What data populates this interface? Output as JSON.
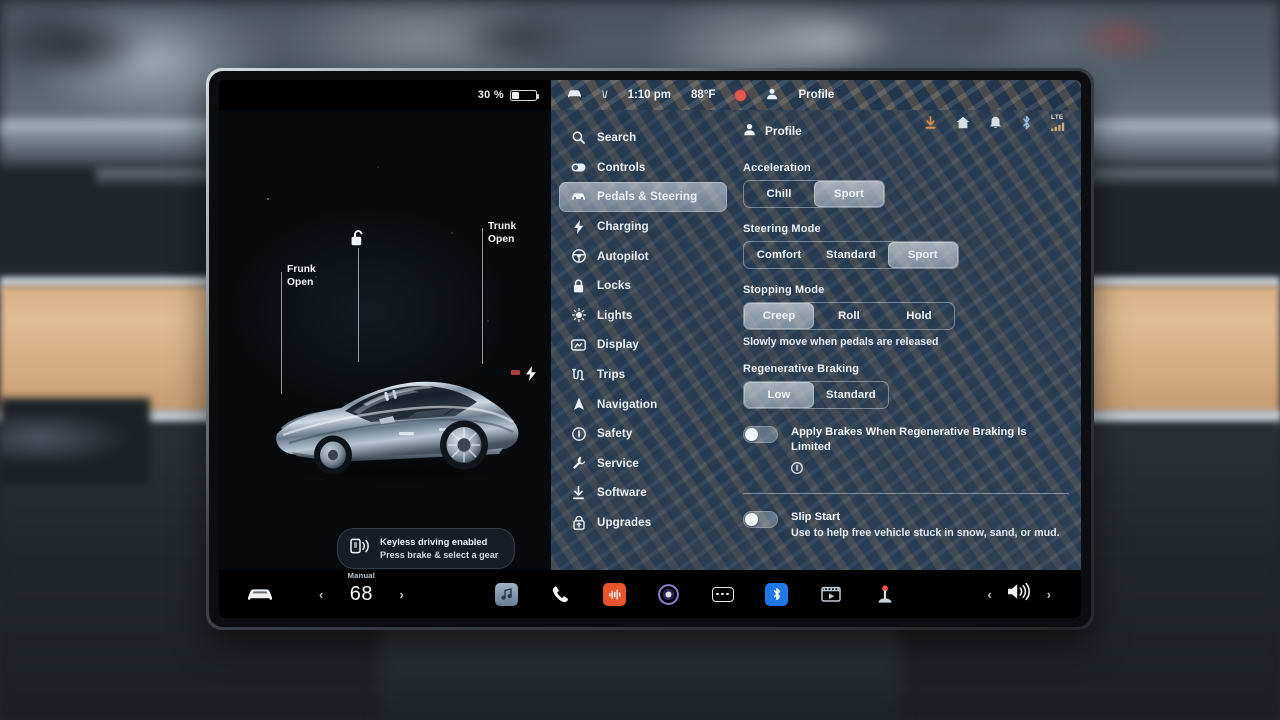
{
  "status_bar": {
    "battery_percent": "30 %",
    "battery_level": 30,
    "time": "1:10 pm",
    "temperature": "88°F",
    "profile_label": "Profile",
    "icons": [
      "download-icon",
      "home-icon",
      "bell-icon",
      "bluetooth-icon",
      "lte-signal-icon"
    ],
    "network": "LTE"
  },
  "sidebar": {
    "items": [
      {
        "label": "Search",
        "icon": "search-icon",
        "selected": false
      },
      {
        "label": "Controls",
        "icon": "controls-icon",
        "selected": false
      },
      {
        "label": "Pedals & Steering",
        "icon": "car-icon",
        "selected": true
      },
      {
        "label": "Charging",
        "icon": "bolt-icon",
        "selected": false
      },
      {
        "label": "Autopilot",
        "icon": "steering-wheel-icon",
        "selected": false
      },
      {
        "label": "Locks",
        "icon": "lock-icon",
        "selected": false
      },
      {
        "label": "Lights",
        "icon": "sun-icon",
        "selected": false
      },
      {
        "label": "Display",
        "icon": "display-icon",
        "selected": false
      },
      {
        "label": "Trips",
        "icon": "trips-icon",
        "selected": false
      },
      {
        "label": "Navigation",
        "icon": "navigation-arrow-icon",
        "selected": false
      },
      {
        "label": "Safety",
        "icon": "safety-info-icon",
        "selected": false
      },
      {
        "label": "Service",
        "icon": "wrench-icon",
        "selected": false
      },
      {
        "label": "Software",
        "icon": "download-icon",
        "selected": false
      },
      {
        "label": "Upgrades",
        "icon": "upgrades-icon",
        "selected": false
      }
    ]
  },
  "settings": {
    "profile_label": "Profile",
    "profile_icon": "person-icon",
    "acceleration": {
      "label": "Acceleration",
      "options": [
        "Chill",
        "Sport"
      ],
      "selected": "Sport"
    },
    "steering_mode": {
      "label": "Steering Mode",
      "options": [
        "Comfort",
        "Standard",
        "Sport"
      ],
      "selected": "Sport"
    },
    "stopping_mode": {
      "label": "Stopping Mode",
      "options": [
        "Creep",
        "Roll",
        "Hold"
      ],
      "selected": "Creep",
      "hint": "Slowly move when pedals are released"
    },
    "regenerative_braking": {
      "label": "Regenerative Braking",
      "options": [
        "Low",
        "Standard"
      ],
      "selected": "Low"
    },
    "apply_brakes": {
      "title": "Apply Brakes When Regenerative Braking Is Limited",
      "enabled": false,
      "info_icon": "info-icon"
    },
    "slip_start": {
      "title": "Slip Start",
      "subtitle": "Use to help free vehicle stuck in snow, sand, or mud.",
      "enabled": false
    }
  },
  "vehicle": {
    "frunk_label": "Frunk\nOpen",
    "frunk_line1": "Frunk",
    "frunk_line2": "Open",
    "trunk_line1": "Trunk",
    "trunk_line2": "Open",
    "lock_icon": "unlocked-padlock-icon",
    "charge_icon": "charge-bolt-icon",
    "notification": {
      "icon": "keyless-phone-icon",
      "line1": "Keyless driving enabled",
      "line2": "Press brake & select a gear"
    }
  },
  "bottom_bar": {
    "car_icon": "car-icon",
    "prev_chevron": "‹",
    "next_chevron": "›",
    "climate_mode": "Manual",
    "climate_temp": "68",
    "apps": [
      {
        "icon": "media-music-icon",
        "color": "#9fb0c2"
      },
      {
        "icon": "phone-icon",
        "color": "#ffffff"
      },
      {
        "icon": "audio-waveform-icon",
        "color": "#e8542e"
      },
      {
        "icon": "browser-icon",
        "color": "#7a6cc4"
      },
      {
        "icon": "more-dots-icon",
        "color": "#ffffff"
      },
      {
        "icon": "bluetooth-icon",
        "color": "#1f77e8"
      },
      {
        "icon": "theater-video-icon",
        "color": "#b9c4cf"
      },
      {
        "icon": "arcade-joystick-icon",
        "color": "#e85450"
      }
    ],
    "volume_icon": "volume-icon",
    "volume_prev": "‹",
    "volume_next": "›"
  },
  "colors": {
    "accent_orange": "#e8954a",
    "accent_blue": "#1f77e8",
    "accent_red": "#e8542e",
    "panel_blue": "#2e4258",
    "text_light": "#eef3f8"
  }
}
